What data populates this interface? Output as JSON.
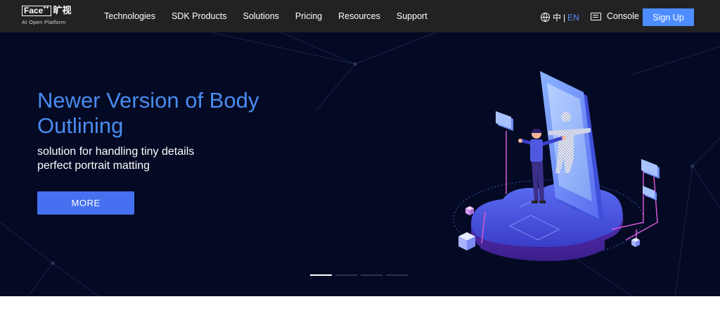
{
  "nav": {
    "logo": {
      "brand": "Face",
      "brand_sup": "++",
      "cn": "旷视",
      "tagline": "AI Open Platform"
    },
    "links": [
      "Technologies",
      "SDK Products",
      "Solutions",
      "Pricing",
      "Resources",
      "Support"
    ],
    "language": {
      "zh": "中",
      "separator": "|",
      "en": "EN",
      "active": "EN"
    },
    "console_label": "Console",
    "signup_label": "Sign Up"
  },
  "hero": {
    "title": "Newer Version of Body Outlining",
    "subtitle_lines": [
      "solution for handling tiny details",
      "perfect portrait matting"
    ],
    "button_label": "MORE",
    "carousel": {
      "slide_count": 4,
      "active_index": 0
    }
  },
  "colors": {
    "nav_bg": "#222222",
    "hero_bg": "#040a24",
    "title_blue": "#4a8cf0",
    "signup_blue": "#4e8dff",
    "more_button": "#4570f0",
    "lang_active": "#5b8dff"
  },
  "icons": {
    "language": "globe-icon",
    "console": "console-icon"
  }
}
